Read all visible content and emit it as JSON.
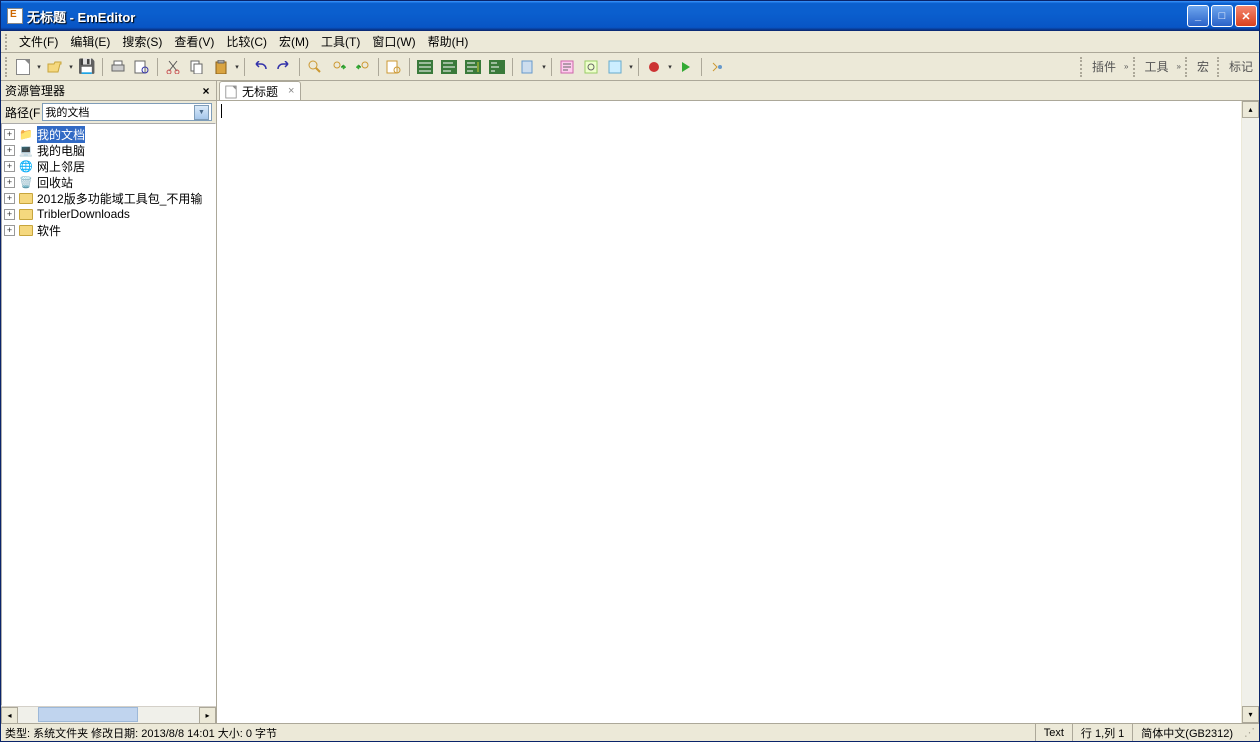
{
  "window": {
    "title": "无标题 - EmEditor"
  },
  "menus": {
    "file": "文件(F)",
    "edit": "编辑(E)",
    "search": "搜索(S)",
    "view": "查看(V)",
    "compare": "比较(C)",
    "macro": "宏(M)",
    "tools": "工具(T)",
    "window": "窗口(W)",
    "help": "帮助(H)"
  },
  "right_tools": {
    "plugins": "插件",
    "tools": "工具",
    "macro": "宏",
    "marks": "标记"
  },
  "explorer": {
    "title": "资源管理器",
    "path_label": "路径(F",
    "path_value": "我的文档",
    "items": [
      {
        "label": "我的文档",
        "icon": "folder-docs",
        "selected": true
      },
      {
        "label": "我的电脑",
        "icon": "computer"
      },
      {
        "label": "网上邻居",
        "icon": "network"
      },
      {
        "label": "回收站",
        "icon": "recycle"
      },
      {
        "label": "2012版多功能域工具包_不用输",
        "icon": "folder"
      },
      {
        "label": "TriblerDownloads",
        "icon": "folder"
      },
      {
        "label": "软件",
        "icon": "folder"
      }
    ]
  },
  "tab": {
    "label": "无标题"
  },
  "status": {
    "left": "类型: 系统文件夹 修改日期: 2013/8/8 14:01 大小: 0 字节",
    "mode": "Text",
    "position": "行 1,列 1",
    "encoding": "简体中文(GB2312)"
  }
}
